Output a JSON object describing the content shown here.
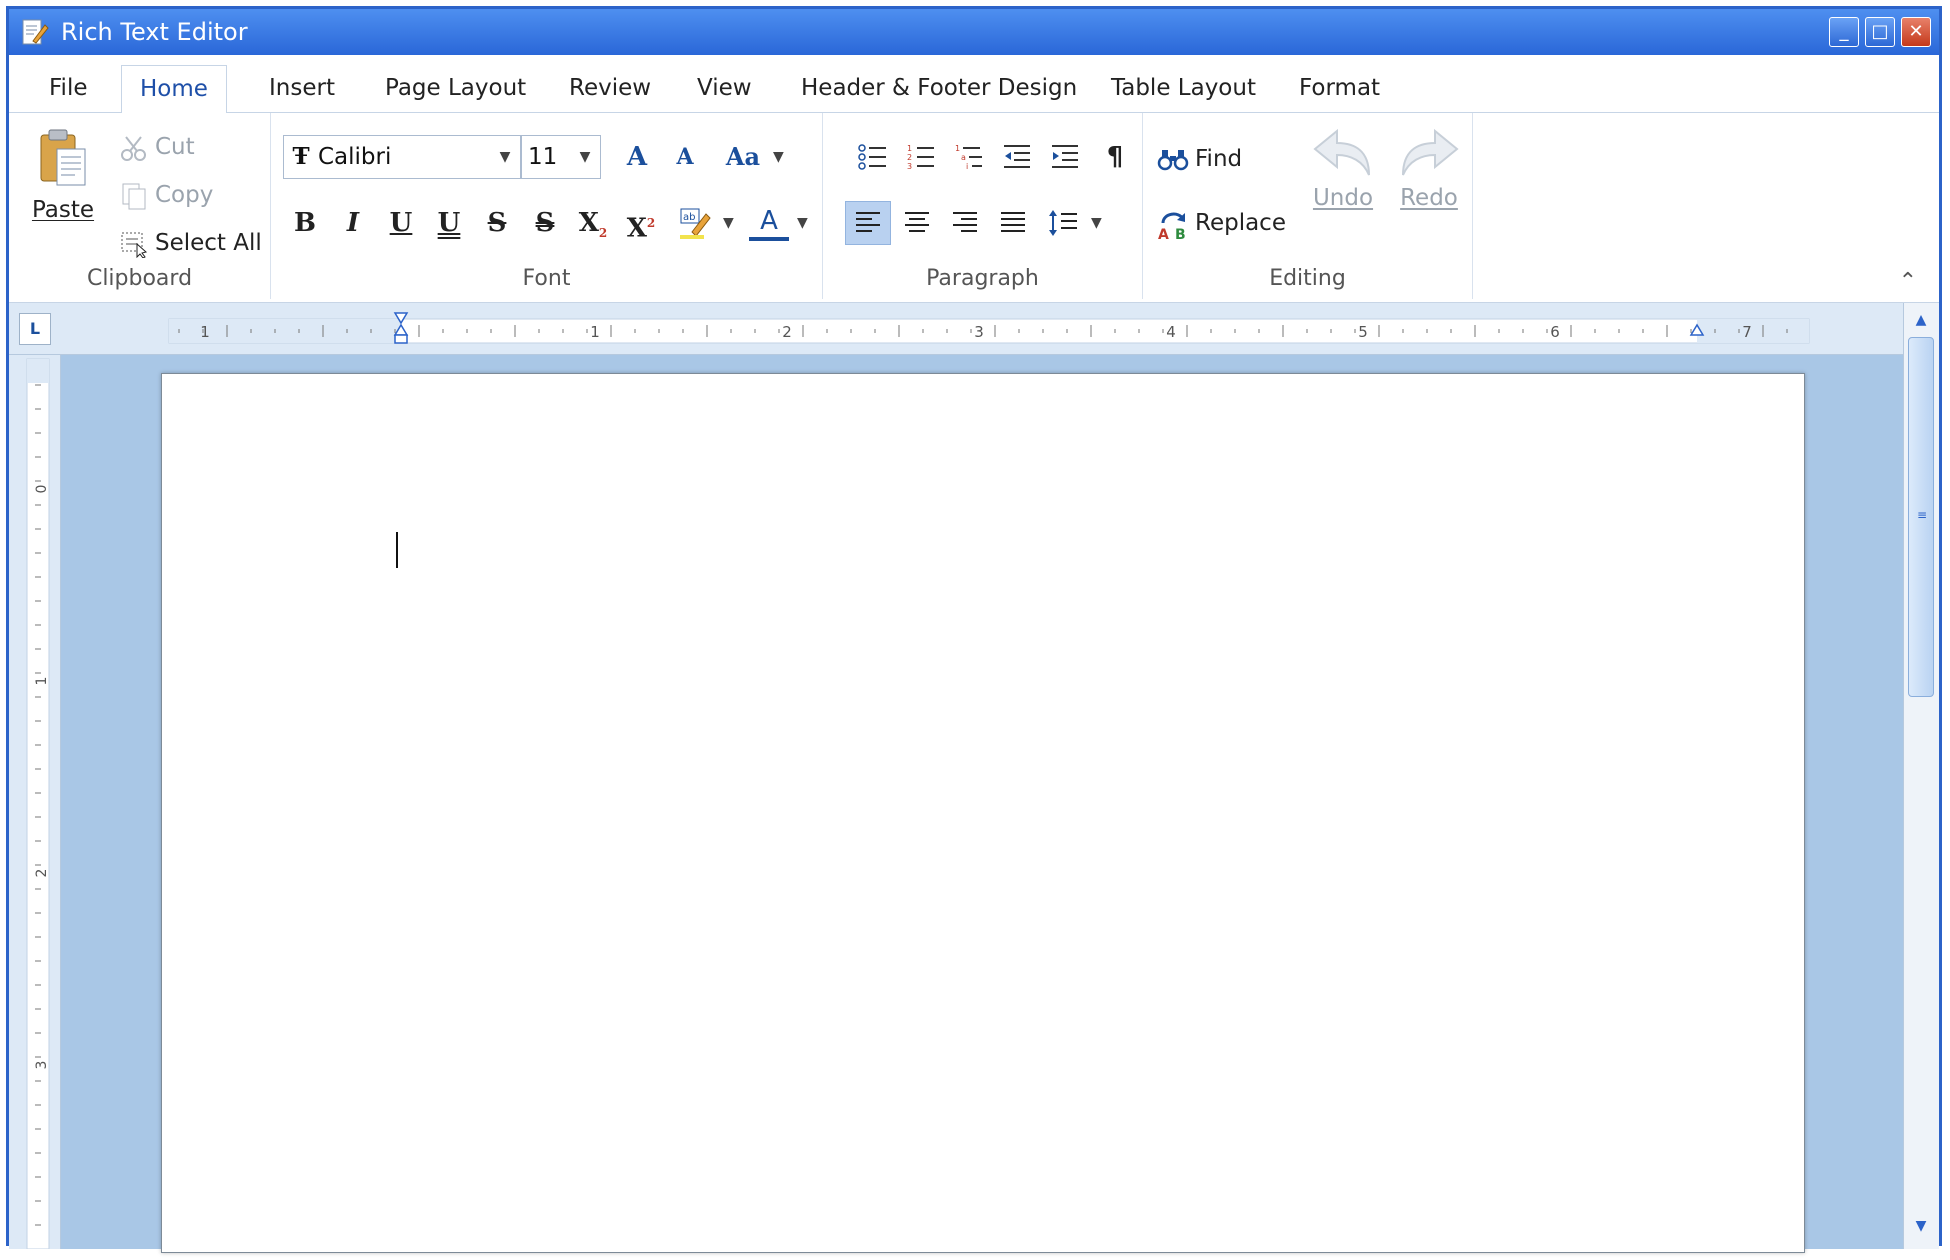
{
  "window": {
    "title": "Rich Text Editor",
    "controls": {
      "minimize": "_",
      "maximize": "□",
      "close": "✕"
    }
  },
  "tabs": [
    {
      "label": "File"
    },
    {
      "label": "Home"
    },
    {
      "label": "Insert"
    },
    {
      "label": "Page Layout"
    },
    {
      "label": "Review"
    },
    {
      "label": "View"
    },
    {
      "label": "Header & Footer Design"
    },
    {
      "label": "Table Layout"
    },
    {
      "label": "Format"
    }
  ],
  "active_tab": "Home",
  "ribbon": {
    "clipboard": {
      "label": "Clipboard",
      "paste": "Paste",
      "cut": "Cut",
      "copy": "Copy",
      "select_all": "Select All"
    },
    "font": {
      "label": "Font",
      "font_name": "Calibri",
      "font_size": "11",
      "buttons": {
        "bold": "B",
        "italic": "I",
        "underline": "U",
        "double_underline": "U",
        "strikethrough": "S",
        "double_strikethrough": "S",
        "subscript": "X",
        "superscript": "X",
        "font_color": "A",
        "grow_font": "A",
        "shrink_font": "A",
        "change_case": "Aa"
      }
    },
    "paragraph": {
      "label": "Paragraph",
      "show_marks": "¶",
      "active_alignment": "align-left"
    },
    "editing": {
      "label": "Editing",
      "find": "Find",
      "replace": "Replace",
      "undo": "Undo",
      "redo": "Redo"
    }
  },
  "ruler": {
    "corner": "L",
    "h_numbers": [
      "1",
      "1",
      "2",
      "3",
      "4",
      "5",
      "6",
      "7"
    ],
    "v_numbers": [
      "0",
      "1",
      "2",
      "3"
    ]
  },
  "colors": {
    "window_blue": "#2a68d8",
    "doc_background": "#a9c7e6",
    "ribbon_text_blue": "#1b4f9c",
    "disabled_text": "#9aa3ad"
  }
}
